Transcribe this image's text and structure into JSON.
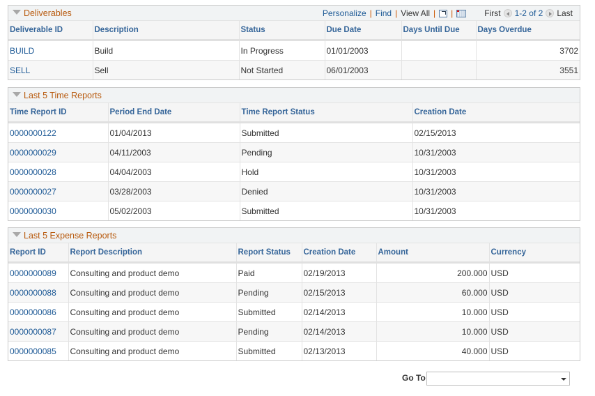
{
  "deliverables": {
    "title": "Deliverables",
    "toolbar": {
      "personalize": "Personalize",
      "find": "Find",
      "view_all": "View All",
      "sep": "|",
      "zoom_icon": "zoom-window-icon",
      "download_icon": "download-grid-icon",
      "first": "First",
      "range": "1-2 of 2",
      "last": "Last"
    },
    "columns": [
      "Deliverable ID",
      "Description",
      "Status",
      "Due Date",
      "Days Until Due",
      "Days Overdue"
    ],
    "rows": [
      {
        "id": "BUILD",
        "description": "Build",
        "status": "In Progress",
        "due_date": "01/01/2003",
        "days_until_due": "",
        "days_overdue": "3702"
      },
      {
        "id": "SELL",
        "description": "Sell",
        "status": "Not Started",
        "due_date": "06/01/2003",
        "days_until_due": "",
        "days_overdue": "3551"
      }
    ]
  },
  "time_reports": {
    "title": "Last 5 Time Reports",
    "columns": [
      "Time Report ID",
      "Period End Date",
      "Time Report Status",
      "Creation Date"
    ],
    "rows": [
      {
        "id": "0000000122",
        "period_end": "01/04/2013",
        "status": "Submitted",
        "created": "02/15/2013"
      },
      {
        "id": "0000000029",
        "period_end": "04/11/2003",
        "status": "Pending",
        "created": "10/31/2003"
      },
      {
        "id": "0000000028",
        "period_end": "04/04/2003",
        "status": "Hold",
        "created": "10/31/2003"
      },
      {
        "id": "0000000027",
        "period_end": "03/28/2003",
        "status": "Denied",
        "created": "10/31/2003"
      },
      {
        "id": "0000000030",
        "period_end": "05/02/2003",
        "status": "Submitted",
        "created": "10/31/2003"
      }
    ]
  },
  "expense_reports": {
    "title": "Last 5 Expense Reports",
    "columns": [
      "Report ID",
      "Report Description",
      "Report Status",
      "Creation Date",
      "Amount",
      "Currency"
    ],
    "rows": [
      {
        "id": "0000000089",
        "description": "Consulting and product demo",
        "status": "Paid",
        "created": "02/19/2013",
        "amount": "200.000",
        "currency": "USD"
      },
      {
        "id": "0000000088",
        "description": "Consulting and product demo",
        "status": "Pending",
        "created": "02/15/2013",
        "amount": "60.000",
        "currency": "USD"
      },
      {
        "id": "0000000086",
        "description": "Consulting and product demo",
        "status": "Submitted",
        "created": "02/14/2013",
        "amount": "10.000",
        "currency": "USD"
      },
      {
        "id": "0000000087",
        "description": "Consulting and product demo",
        "status": "Pending",
        "created": "02/14/2013",
        "amount": "10.000",
        "currency": "USD"
      },
      {
        "id": "0000000085",
        "description": "Consulting and product demo",
        "status": "Submitted",
        "created": "02/13/2013",
        "amount": "40.000",
        "currency": "USD"
      }
    ]
  },
  "goto": {
    "label": "Go To",
    "selected": ""
  },
  "colors": {
    "section_title": "#b85a0e",
    "link": "#1e5a96",
    "header_text": "#356599"
  }
}
